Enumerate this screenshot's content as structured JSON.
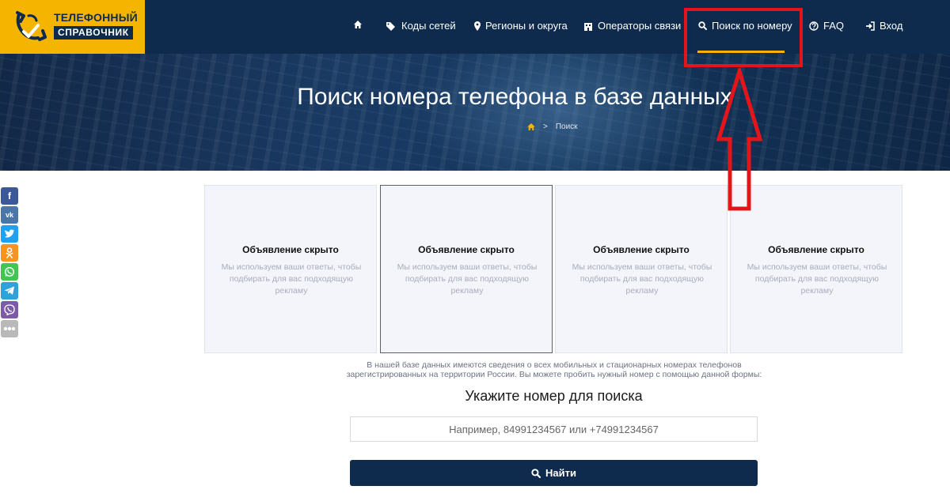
{
  "logo": {
    "line1": "ТЕЛЕФОННЫЙ",
    "line2": "СПРАВОЧНИК"
  },
  "nav": {
    "home_icon": "home-icon",
    "items": [
      {
        "label": "Коды сетей",
        "icon": "tags-icon"
      },
      {
        "label": "Регионы и округа",
        "icon": "map-marker-icon"
      },
      {
        "label": "Операторы связи",
        "icon": "building-icon"
      },
      {
        "label": "Поиск по номеру",
        "icon": "search-icon",
        "active": true
      },
      {
        "label": "FAQ",
        "icon": "question-circle-icon"
      },
      {
        "label": "Вход",
        "icon": "sign-in-icon"
      }
    ]
  },
  "hero": {
    "title": "Поиск номера телефона в базе данных",
    "breadcrumb": {
      "separator": ">",
      "current": "Поиск"
    }
  },
  "social": [
    "facebook",
    "vk",
    "twitter",
    "odnoklassniki",
    "whatsapp",
    "telegram",
    "viber",
    "more"
  ],
  "ads": [
    {
      "title": "Объявление скрыто",
      "text": "Мы используем ваши ответы, чтобы подбирать для вас подходящую рекламу"
    },
    {
      "title": "Объявление скрыто",
      "text": "Мы используем ваши ответы, чтобы подбирать для вас подходящую рекламу"
    },
    {
      "title": "Объявление скрыто",
      "text": "Мы используем ваши ответы, чтобы подбирать для вас подходящую рекламу"
    },
    {
      "title": "Объявление скрыто",
      "text": "Мы используем ваши ответы, чтобы подбирать для вас подходящую рекламу"
    }
  ],
  "search": {
    "info": "В нашей базе данных имеются сведения о всех мобильных и стационарных номерах телефонов зарегистрированных на территории России. Вы можете пробить нужный номер с помощью данной формы:",
    "title": "Укажите номер для поиска",
    "placeholder": "Например, 84991234567 или +74991234567",
    "button_label": "Найти"
  },
  "colors": {
    "brand_yellow": "#f5b400",
    "navy": "#0e2a4c",
    "annotation_red": "#e3151a"
  }
}
